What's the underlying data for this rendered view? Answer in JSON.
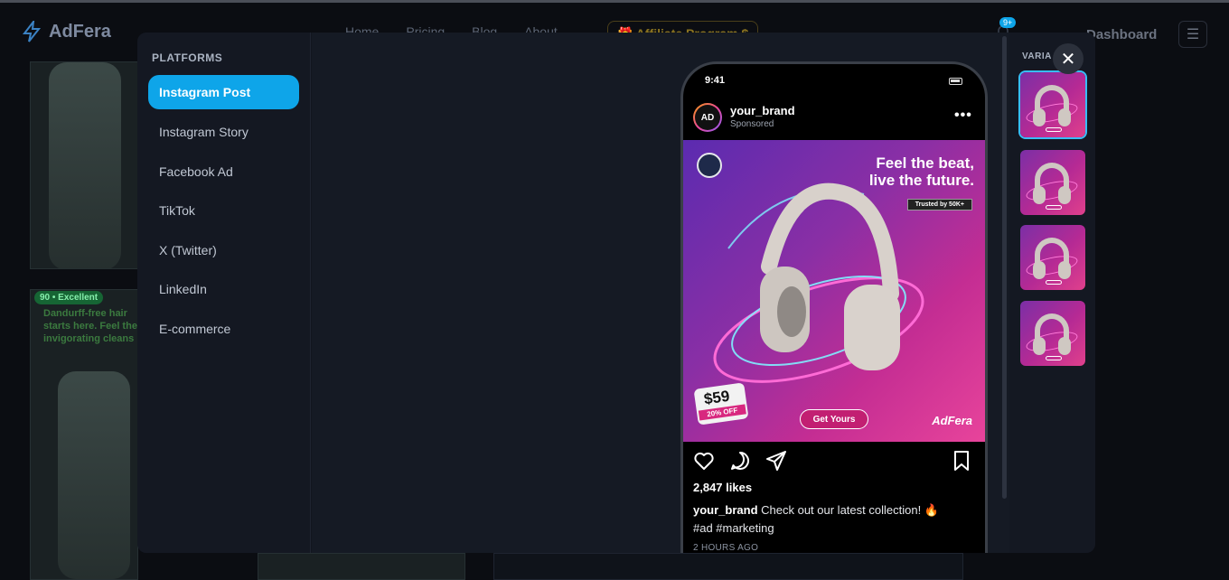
{
  "background": {
    "brand": "AdFera",
    "nav": [
      "Home",
      "Pricing",
      "Blog",
      "About"
    ],
    "affiliate": "🎁 Affiliate Program $",
    "notification_badge": "9+",
    "dashboard": "Dashboard",
    "card_score_badge": "90 • Excellent",
    "card_text": "Dandurff-free hair starts here. Feel the invigorating cleans"
  },
  "modal": {
    "platforms_title": "PLATFORMS",
    "platforms": [
      {
        "label": "Instagram Post",
        "active": true
      },
      {
        "label": "Instagram Story",
        "active": false
      },
      {
        "label": "Facebook Ad",
        "active": false
      },
      {
        "label": "TikTok",
        "active": false
      },
      {
        "label": "X (Twitter)",
        "active": false
      },
      {
        "label": "LinkedIn",
        "active": false
      },
      {
        "label": "E-commerce",
        "active": false
      }
    ],
    "variants_title": "VARIA",
    "close_icon": "close-icon"
  },
  "preview": {
    "status_time": "9:41",
    "avatar_text": "AD",
    "username": "your_brand",
    "sponsored": "Sponsored",
    "ad": {
      "headline_line1": "Feel the beat,",
      "headline_line2": "live the future.",
      "trust": "Trusted by 50K+",
      "price": "$59",
      "discount": "20% OFF",
      "cta": "Get Yours",
      "brand": "AdFera"
    },
    "likes": "2,847 likes",
    "caption_user": "your_brand",
    "caption_text": "Check out our latest collection! 🔥",
    "caption_tags": "#ad #marketing",
    "time_ago": "2 HOURS AGO"
  },
  "colors": {
    "accent": "#0ea5e9",
    "ad_gradient_start": "#5b2bb0",
    "ad_gradient_end": "#e8449b"
  }
}
